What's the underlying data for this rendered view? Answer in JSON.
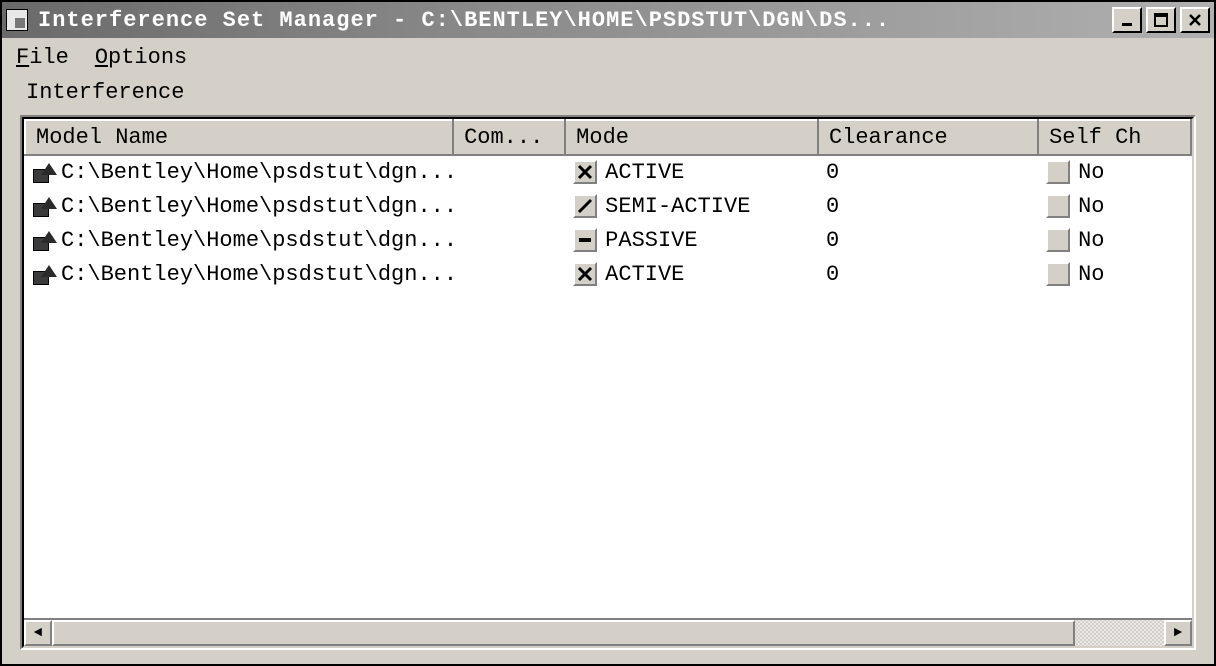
{
  "window": {
    "title": "Interference Set Manager - C:\\BENTLEY\\HOME\\PSDSTUT\\DGN\\DS..."
  },
  "menu": {
    "file": {
      "underline": "F",
      "rest": "ile"
    },
    "options": {
      "underline": "O",
      "rest": "ptions"
    }
  },
  "section": {
    "label": "Interference"
  },
  "columns": {
    "model": "Model Name",
    "com": "Com...",
    "mode": "Mode",
    "clearance": "Clearance",
    "self": "Self Ch"
  },
  "rows": [
    {
      "model": "C:\\Bentley\\Home\\psdstut\\dgn...",
      "com": "",
      "mode_icon": "x",
      "mode": "ACTIVE",
      "clearance": "0",
      "self": "No"
    },
    {
      "model": "C:\\Bentley\\Home\\psdstut\\dgn...",
      "com": "",
      "mode_icon": "slash",
      "mode": "SEMI-ACTIVE",
      "clearance": "0",
      "self": "No"
    },
    {
      "model": "C:\\Bentley\\Home\\psdstut\\dgn...",
      "com": "",
      "mode_icon": "dash",
      "mode": "PASSIVE",
      "clearance": "0",
      "self": "No"
    },
    {
      "model": "C:\\Bentley\\Home\\psdstut\\dgn...",
      "com": "",
      "mode_icon": "x",
      "mode": "ACTIVE",
      "clearance": "0",
      "self": "No"
    }
  ]
}
